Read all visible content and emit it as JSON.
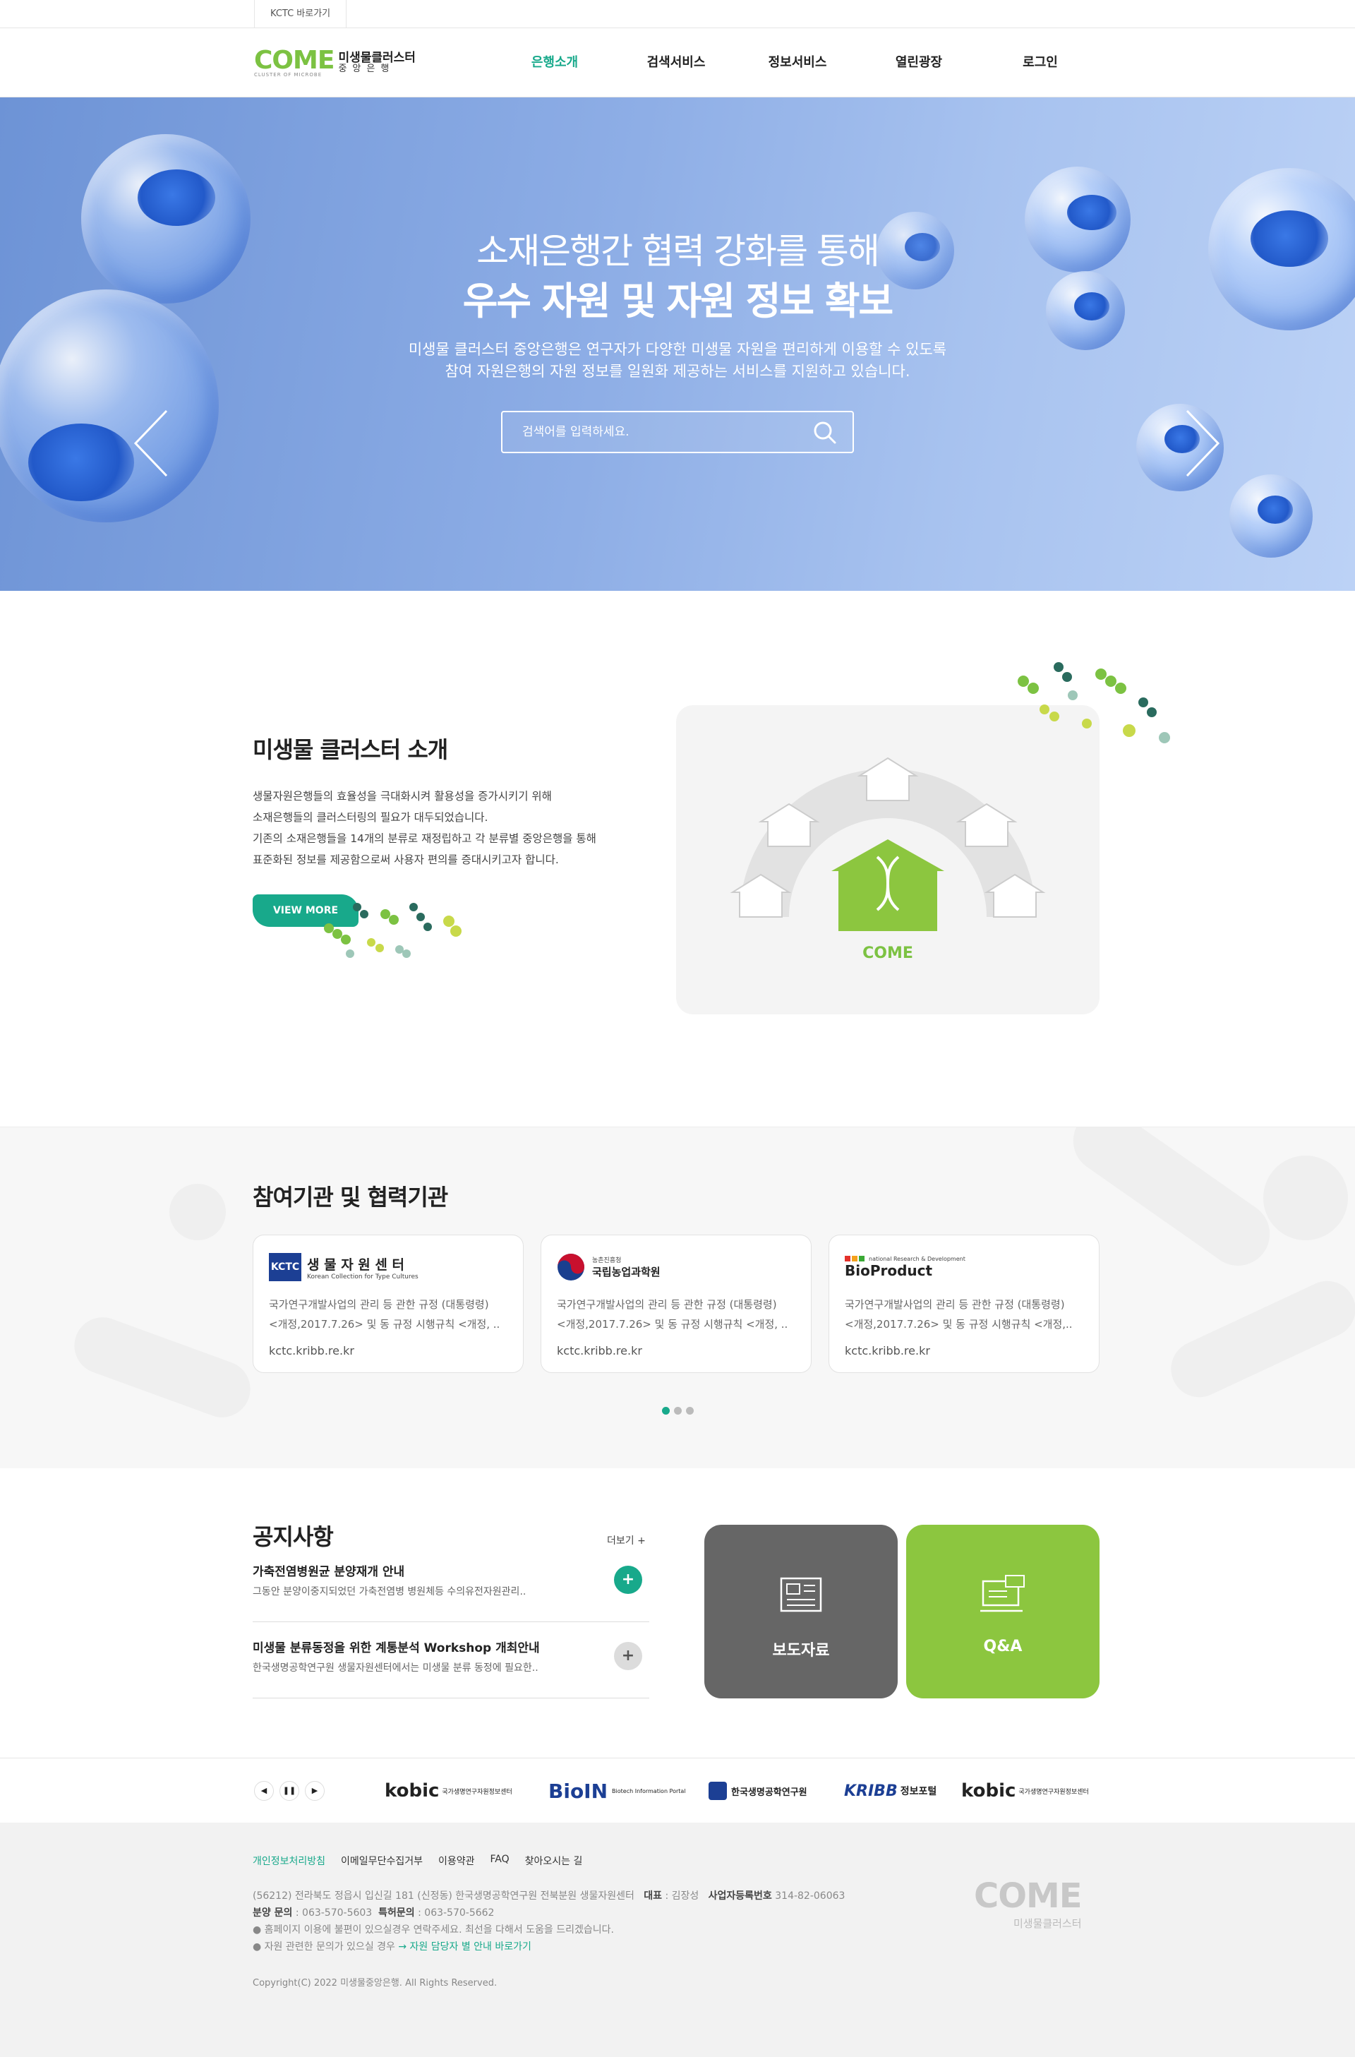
{
  "topbar": {
    "kctc_link": "KCTC 바로가기"
  },
  "logo": {
    "mark": "COME",
    "sub": "CLUSTER OF MICROBE",
    "name": "미생물클러스터",
    "name2": "중앙은행"
  },
  "nav": [
    {
      "label": "은행소개",
      "active": true
    },
    {
      "label": "검색서비스"
    },
    {
      "label": "정보서비스"
    },
    {
      "label": "열린광장"
    },
    {
      "label": "로그인"
    }
  ],
  "hero": {
    "title1": "소재은행간 협력 강화를 통해",
    "title2": "우수 자원 및 자원 정보 확보",
    "desc1": "미생물 클러스터 중앙은행은 연구자가 다양한 미생물 자원을 편리하게 이용할 수 있도록",
    "desc2": "참여 자원은행의 자원 정보를 일원화 제공하는 서비스를 지원하고 있습니다.",
    "search_placeholder": "검색어를 입력하세요."
  },
  "intro": {
    "title": "미생물 클러스터 소개",
    "lines": [
      "생물자원은행들의 효율성을 극대화시켜 활용성을 증가시키기 위해",
      "소재은행들의 클러스터링의 필요가 대두되었습니다.",
      "기존의 소재은행들을 14개의 분류로 재정립하고 각 분류별 중앙은행을 통해",
      "표준화된 정보를 제공함으로써 사용자 편의를 증대시키고자 합니다."
    ],
    "view_more": "VIEW MORE"
  },
  "partners": {
    "title": "참여기관 및 협력기관",
    "cards": [
      {
        "logo": "생 물 자 원 센 터",
        "logo_sub": "Korean Collection for Type Cultures",
        "desc1": "국가연구개발사업의 관리 등 관한 규정 (대통령령)",
        "desc2": "<개정,2017.7.26> 및 동 규정 시행규칙 <개정, ..",
        "url": "kctc.kribb.re.kr"
      },
      {
        "logo": "국립농업과학원",
        "logo_sub": "농촌진흥청",
        "desc1": "국가연구개발사업의 관리 등 관한 규정 (대통령령)",
        "desc2": "<개정,2017.7.26> 및 동 규정 시행규칙 <개정, ..",
        "url": "kctc.kribb.re.kr"
      },
      {
        "logo": "BioProduct",
        "logo_sub": "national Research & Development",
        "desc1": "국가연구개발사업의 관리 등 관한 규정 (대통령령)",
        "desc2": "<개정,2017.7.26> 및 동 규정 시행규칙 <개정,..",
        "url": "kctc.kribb.re.kr"
      }
    ]
  },
  "notice": {
    "title": "공지사항",
    "more": "더보기 +",
    "items": [
      {
        "title": "가축전염병원균 분양재개 안내",
        "desc": "그동안 분양이중지되었던 가축전염병 병원체등 수의유전자원관리.."
      },
      {
        "title": "미생물 분류동정을 위한 계통분석 Workshop 개최안내",
        "desc": "한국생명공학연구원 생물자원센터에서는 미생물 분류 동정에 필요한.."
      }
    ],
    "tiles": [
      {
        "label": "보도자료"
      },
      {
        "label": "Q&A"
      }
    ]
  },
  "family": [
    {
      "name": "kobic",
      "sub": "국가생명연구자원정보센터"
    },
    {
      "name": "BioIN",
      "sub": "Biotech Information Portal"
    },
    {
      "name": "한국생명공학연구원"
    },
    {
      "name": "KRIBB",
      "sub": "정보포털"
    },
    {
      "name": "kobic",
      "sub": "국가생명연구자원정보센터"
    }
  ],
  "footer": {
    "links": [
      "개인정보처리방침",
      "이메일무단수집거부",
      "이용약관",
      "FAQ",
      "찾아오시는 길"
    ],
    "addr": "(56212) 전라북도 정읍시 입신길 181 (신정동) 한국생명공학연구원 전북분원 생물자원센터",
    "ceo_label": "대표",
    "ceo": "김장성",
    "biz_label": "사업자등록번호",
    "biz": "314-82-06063",
    "dist_label": "분양 문의",
    "dist": "063-570-5603",
    "patent_label": "특허문의",
    "patent": "063-570-5662",
    "note1": "● 홈페이지 이용에 불편이 있으실경우 연락주세요. 최선을 다해서 도움을 드리겠습니다.",
    "note2_pre": "● 자원 관련한 문의가 있으실 경우",
    "note2_link": "→ 자원 담당자 별 안내 바로가기",
    "copyright": "Copyright(C) 2022 미생물중앙은행. All Rights Reserved.",
    "logo_mark": "COME",
    "logo_sub": "미생물클러스터"
  }
}
